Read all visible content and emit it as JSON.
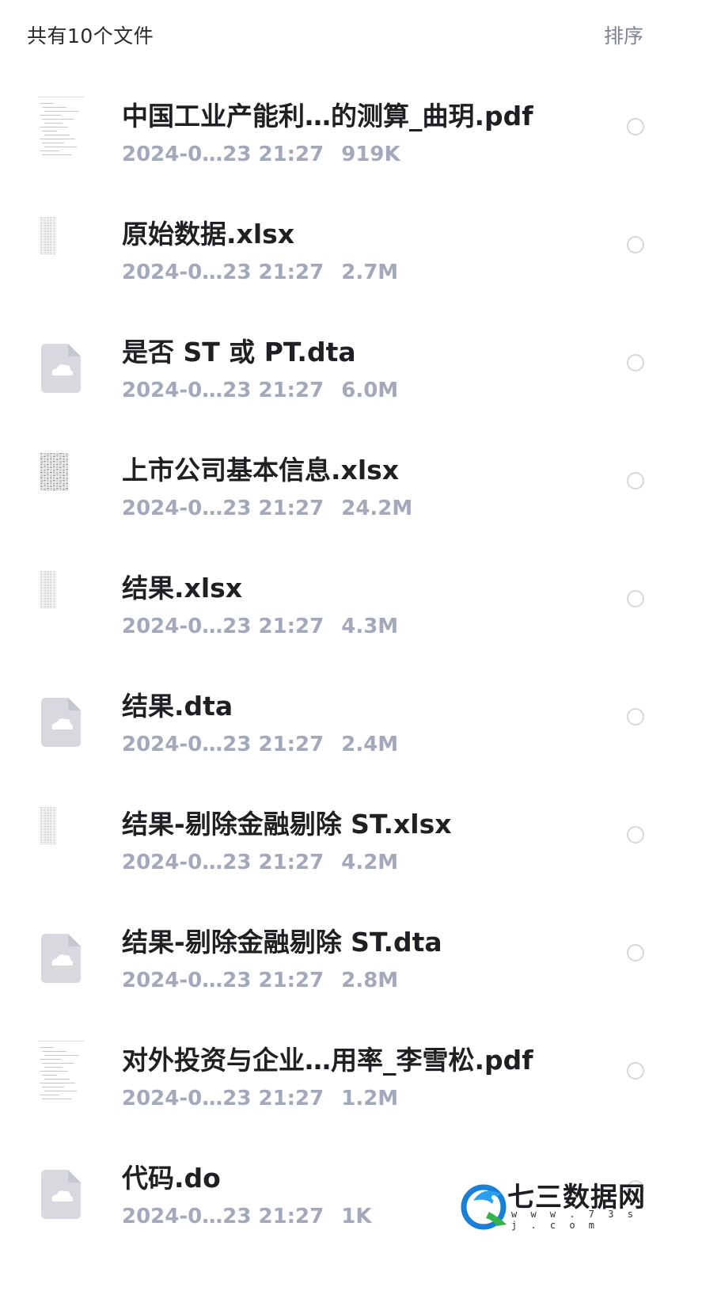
{
  "header": {
    "count_text": "共有10个文件",
    "sort_label": "排序"
  },
  "files": [
    {
      "name": "中国工业产能利…的测算_曲玥.pdf",
      "date": "2024-0…23 21:27",
      "size": "919K",
      "thumb": "pdf-thumbnail"
    },
    {
      "name": "原始数据.xlsx",
      "date": "2024-0…23 21:27",
      "size": "2.7M",
      "thumb": "spreadsheet-thumbnail"
    },
    {
      "name": "是否 ST 或 PT.dta",
      "date": "2024-0…23 21:27",
      "size": "6.0M",
      "thumb": "cloud-file-icon"
    },
    {
      "name": "上市公司基本信息.xlsx",
      "date": "2024-0…23 21:27",
      "size": "24.2M",
      "thumb": "spreadsheet-thumbnail-dense"
    },
    {
      "name": "结果.xlsx",
      "date": "2024-0…23 21:27",
      "size": "4.3M",
      "thumb": "spreadsheet-thumbnail"
    },
    {
      "name": "结果.dta",
      "date": "2024-0…23 21:27",
      "size": "2.4M",
      "thumb": "cloud-file-icon"
    },
    {
      "name": "结果-剔除金融剔除 ST.xlsx",
      "date": "2024-0…23 21:27",
      "size": "4.2M",
      "thumb": "spreadsheet-thumbnail"
    },
    {
      "name": "结果-剔除金融剔除 ST.dta",
      "date": "2024-0…23 21:27",
      "size": "2.8M",
      "thumb": "cloud-file-icon"
    },
    {
      "name": "对外投资与企业…用率_李雪松.pdf",
      "date": "2024-0…23 21:27",
      "size": "1.2M",
      "thumb": "pdf-thumbnail"
    },
    {
      "name": "代码.do",
      "date": "2024-0…23 21:27",
      "size": "1K",
      "thumb": "cloud-file-icon"
    }
  ],
  "watermark": {
    "title": "七三数据网",
    "url": "w w w . 7 3 s j . c o m"
  },
  "colors": {
    "name_text": "#1f1f24",
    "meta_text": "#a3a8bb",
    "cloud_tile": "#d7d9df",
    "radio_border": "#d6d8de"
  }
}
